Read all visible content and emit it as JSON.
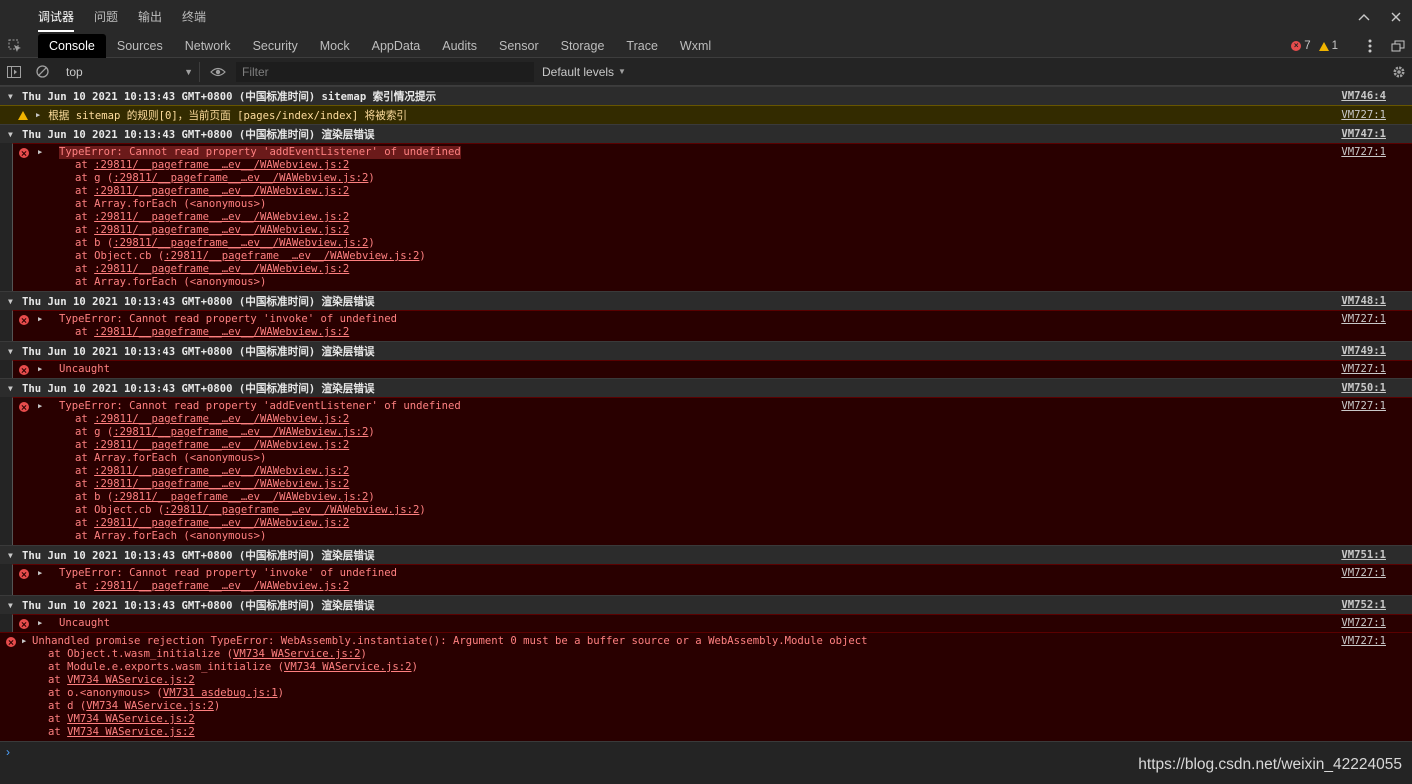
{
  "panel_tabs": [
    "调试器",
    "问题",
    "输出",
    "终端"
  ],
  "devtools_tabs": [
    "Console",
    "Sources",
    "Network",
    "Security",
    "Mock",
    "AppData",
    "Audits",
    "Sensor",
    "Storage",
    "Trace",
    "Wxml"
  ],
  "counts": {
    "errors": "7",
    "warnings": "1"
  },
  "filterbar": {
    "context": "top",
    "filter_placeholder": "Filter",
    "levels": "Default levels"
  },
  "groups": [
    {
      "header": "Thu Jun 10 2021 10:13:43 GMT+0800 (中国标准时间) sitemap 索引情况提示",
      "source": "VM746:4",
      "warning": {
        "text": "根据 sitemap 的规则[0]，当前页面 [pages/index/index] 将被索引",
        "source": "VM727:1"
      }
    },
    {
      "header": "Thu Jun 10 2021 10:13:43 GMT+0800 (中国标准时间) 渲染层错误",
      "source": "VM747:1",
      "error": {
        "text": "TypeError: Cannot read property 'addEventListener' of undefined",
        "source": "VM727:1",
        "highlight": true,
        "stack": [
          {
            "pre": "at ",
            "link": ":29811/__pageframe__…ev__/WAWebview.js:2",
            "post": ""
          },
          {
            "pre": "at g (",
            "link": ":29811/__pageframe__…ev__/WAWebview.js:2",
            "post": ")"
          },
          {
            "pre": "at ",
            "link": ":29811/__pageframe__…ev__/WAWebview.js:2",
            "post": ""
          },
          {
            "pre": "at Array.forEach (<anonymous>)",
            "link": "",
            "post": ""
          },
          {
            "pre": "at ",
            "link": ":29811/__pageframe__…ev__/WAWebview.js:2",
            "post": ""
          },
          {
            "pre": "at ",
            "link": ":29811/__pageframe__…ev__/WAWebview.js:2",
            "post": ""
          },
          {
            "pre": "at b (",
            "link": ":29811/__pageframe__…ev__/WAWebview.js:2",
            "post": ")"
          },
          {
            "pre": "at Object.cb (",
            "link": ":29811/__pageframe__…ev__/WAWebview.js:2",
            "post": ")"
          },
          {
            "pre": "at ",
            "link": ":29811/__pageframe__…ev__/WAWebview.js:2",
            "post": ""
          },
          {
            "pre": "at Array.forEach (<anonymous>)",
            "link": "",
            "post": ""
          }
        ]
      }
    },
    {
      "header": "Thu Jun 10 2021 10:13:43 GMT+0800 (中国标准时间) 渲染层错误",
      "source": "VM748:1",
      "error": {
        "text": "TypeError: Cannot read property 'invoke' of undefined",
        "source": "VM727:1",
        "stack": [
          {
            "pre": "at ",
            "link": ":29811/__pageframe__…ev__/WAWebview.js:2",
            "post": ""
          }
        ]
      }
    },
    {
      "header": "Thu Jun 10 2021 10:13:43 GMT+0800 (中国标准时间) 渲染层错误",
      "source": "VM749:1",
      "error": {
        "text": "Uncaught",
        "source": "VM727:1",
        "stack": []
      }
    },
    {
      "header": "Thu Jun 10 2021 10:13:43 GMT+0800 (中国标准时间) 渲染层错误",
      "source": "VM750:1",
      "error": {
        "text": "TypeError: Cannot read property 'addEventListener' of undefined",
        "source": "VM727:1",
        "stack": [
          {
            "pre": "at ",
            "link": ":29811/__pageframe__…ev__/WAWebview.js:2",
            "post": ""
          },
          {
            "pre": "at g (",
            "link": ":29811/__pageframe__…ev__/WAWebview.js:2",
            "post": ")"
          },
          {
            "pre": "at ",
            "link": ":29811/__pageframe__…ev__/WAWebview.js:2",
            "post": ""
          },
          {
            "pre": "at Array.forEach (<anonymous>)",
            "link": "",
            "post": ""
          },
          {
            "pre": "at ",
            "link": ":29811/__pageframe__…ev__/WAWebview.js:2",
            "post": ""
          },
          {
            "pre": "at ",
            "link": ":29811/__pageframe__…ev__/WAWebview.js:2",
            "post": ""
          },
          {
            "pre": "at b (",
            "link": ":29811/__pageframe__…ev__/WAWebview.js:2",
            "post": ")"
          },
          {
            "pre": "at Object.cb (",
            "link": ":29811/__pageframe__…ev__/WAWebview.js:2",
            "post": ")"
          },
          {
            "pre": "at ",
            "link": ":29811/__pageframe__…ev__/WAWebview.js:2",
            "post": ""
          },
          {
            "pre": "at Array.forEach (<anonymous>)",
            "link": "",
            "post": ""
          }
        ]
      }
    },
    {
      "header": "Thu Jun 10 2021 10:13:43 GMT+0800 (中国标准时间) 渲染层错误",
      "source": "VM751:1",
      "error": {
        "text": "TypeError: Cannot read property 'invoke' of undefined",
        "source": "VM727:1",
        "stack": [
          {
            "pre": "at ",
            "link": ":29811/__pageframe__…ev__/WAWebview.js:2",
            "post": ""
          }
        ]
      }
    },
    {
      "header": "Thu Jun 10 2021 10:13:43 GMT+0800 (中国标准时间) 渲染层错误",
      "source": "VM752:1",
      "error": {
        "text": "Uncaught",
        "source": "VM727:1",
        "stack": []
      }
    }
  ],
  "final_error": {
    "text": "Unhandled promise rejection TypeError: WebAssembly.instantiate(): Argument 0 must be a buffer source or a WebAssembly.Module object",
    "source": "VM727:1",
    "stack": [
      {
        "pre": "at Object.t.wasm_initialize (",
        "link": "VM734 WAService.js:2",
        "post": ")"
      },
      {
        "pre": "at Module.e.exports.wasm_initialize (",
        "link": "VM734 WAService.js:2",
        "post": ")"
      },
      {
        "pre": "at ",
        "link": "VM734 WAService.js:2",
        "post": ""
      },
      {
        "pre": "at o.<anonymous> (",
        "link": "VM731 asdebug.js:1",
        "post": ")"
      },
      {
        "pre": "at d (",
        "link": "VM734 WAService.js:2",
        "post": ")"
      },
      {
        "pre": "at ",
        "link": "VM734 WAService.js:2",
        "post": ""
      },
      {
        "pre": "at ",
        "link": "VM734 WAService.js:2",
        "post": ""
      }
    ]
  },
  "prompt_symbol": "›",
  "watermark": "https://blog.csdn.net/weixin_42224055",
  "colors": {
    "error_bg": "#290000",
    "error_text": "#ff8080",
    "warning_bg": "#332b00",
    "accent_blue": "#4ea3ff"
  }
}
